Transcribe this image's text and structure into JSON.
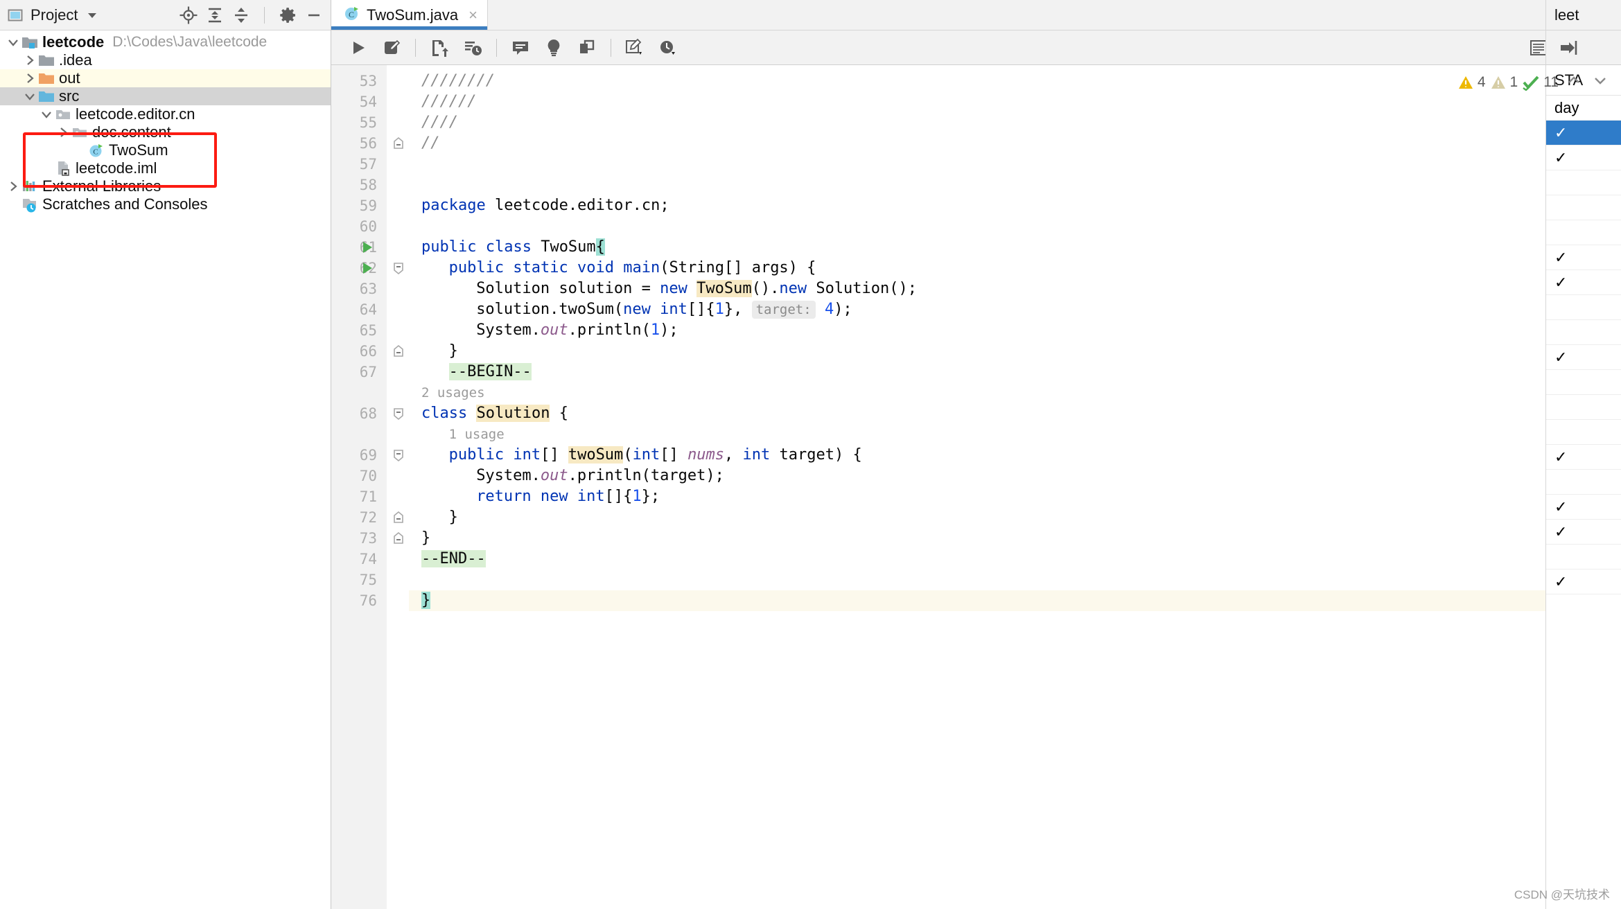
{
  "sidebar": {
    "title": "Project",
    "header_icons": [
      "project-view-icon",
      "chevron-down-icon",
      "locate-icon",
      "expand-all-icon",
      "collapse-all-icon",
      "settings-gear-icon",
      "minimize-icon"
    ],
    "tree": [
      {
        "label": "leetcode",
        "path": "D:\\Codes\\Java\\leetcode",
        "icon": "module-folder-icon",
        "arrow": "expanded",
        "indent": 0,
        "bold": true,
        "state": "normal"
      },
      {
        "label": ".idea",
        "path": "",
        "icon": "folder-grey-icon",
        "arrow": "collapsed",
        "indent": 1,
        "bold": false,
        "state": "normal"
      },
      {
        "label": "out",
        "path": "",
        "icon": "folder-orange-icon",
        "arrow": "collapsed",
        "indent": 1,
        "bold": false,
        "state": "yellow"
      },
      {
        "label": "src",
        "path": "",
        "icon": "folder-blue-icon",
        "arrow": "expanded",
        "indent": 1,
        "bold": false,
        "state": "selected"
      },
      {
        "label": "leetcode.editor.cn",
        "path": "",
        "icon": "package-icon",
        "arrow": "expanded",
        "indent": 2,
        "bold": false,
        "state": "normal"
      },
      {
        "label": "doc.content",
        "path": "",
        "icon": "package-icon",
        "arrow": "collapsed",
        "indent": 3,
        "bold": false,
        "state": "normal"
      },
      {
        "label": "TwoSum",
        "path": "",
        "icon": "java-class-icon",
        "arrow": "none",
        "indent": 4,
        "bold": false,
        "state": "normal"
      },
      {
        "label": "leetcode.iml",
        "path": "",
        "icon": "iml-file-icon",
        "arrow": "none",
        "indent": 2,
        "bold": false,
        "state": "normal"
      },
      {
        "label": "External Libraries",
        "path": "",
        "icon": "libraries-icon",
        "arrow": "collapsed",
        "indent": 0,
        "bold": false,
        "state": "normal"
      },
      {
        "label": "Scratches and Consoles",
        "path": "",
        "icon": "scratches-icon",
        "arrow": "none",
        "indent": 0,
        "bold": false,
        "state": "normal"
      }
    ],
    "highlight_box": {
      "color": "#fc1b12",
      "around": [
        "leetcode.editor.cn",
        "doc.content",
        "TwoSum"
      ]
    }
  },
  "editor": {
    "tab": {
      "label": "TwoSum.java",
      "icon": "java-class-icon",
      "close": "×",
      "active": true,
      "accent": "#3c7ec0"
    },
    "tabbar_kebab": "more-options-icon",
    "toolbar_icons": [
      "run-icon",
      "edit-submission-icon",
      "submit-icon",
      "timer-submit-icon",
      "comment-icon",
      "idea-bulb-icon",
      "note-icon",
      "edit-note-icon",
      "history-clock-icon"
    ],
    "right_toolbar_icons": [
      "list-view-icon",
      "split-view-icon",
      "image-view-icon",
      "open-panel-icon"
    ],
    "inspections": {
      "warning_count": "4",
      "weak_warning_count": "1",
      "ok_count": "11",
      "up_icon": "chevron-up-icon",
      "down_icon": "chevron-down-icon",
      "warning_color": "#edb800",
      "weak_color": "#d6cda6",
      "ok_color": "#4caf50"
    },
    "first_line_number": 53,
    "lines": [
      {
        "n": 53,
        "indent": 0,
        "tokens": [
          {
            "t": "comment",
            "v": "////////"
          }
        ]
      },
      {
        "n": 54,
        "indent": 0,
        "tokens": [
          {
            "t": "comment",
            "v": "//////"
          }
        ]
      },
      {
        "n": 55,
        "indent": 0,
        "tokens": [
          {
            "t": "comment",
            "v": "////"
          }
        ]
      },
      {
        "n": 56,
        "indent": 0,
        "fold": "end",
        "tokens": [
          {
            "t": "comment",
            "v": "//"
          }
        ]
      },
      {
        "n": 57,
        "indent": 0,
        "tokens": []
      },
      {
        "n": 58,
        "indent": 0,
        "tokens": []
      },
      {
        "n": 59,
        "indent": 0,
        "tokens": [
          {
            "t": "kw",
            "v": "package"
          },
          {
            "t": "plain",
            "v": " leetcode.editor.cn;"
          }
        ]
      },
      {
        "n": 60,
        "indent": 0,
        "tokens": []
      },
      {
        "n": 61,
        "indent": 0,
        "run": true,
        "tokens": [
          {
            "t": "kw",
            "v": "public class"
          },
          {
            "t": "plain",
            "v": " TwoSum"
          },
          {
            "t": "cyan",
            "v": "{"
          }
        ]
      },
      {
        "n": 62,
        "indent": 1,
        "run": true,
        "fold": "start",
        "tokens": [
          {
            "t": "kw",
            "v": "public static void"
          },
          {
            "t": "plain",
            "v": " "
          },
          {
            "t": "method",
            "v": "main"
          },
          {
            "t": "plain",
            "v": "(String[] args) {"
          }
        ]
      },
      {
        "n": 63,
        "indent": 2,
        "tokens": [
          {
            "t": "plain",
            "v": "Solution solution = "
          },
          {
            "t": "kw",
            "v": "new"
          },
          {
            "t": "plain",
            "v": " "
          },
          {
            "t": "hl",
            "v": "TwoSum"
          },
          {
            "t": "plain",
            "v": "()."
          },
          {
            "t": "kw",
            "v": "new"
          },
          {
            "t": "plain",
            "v": " Solution();"
          }
        ]
      },
      {
        "n": 64,
        "indent": 2,
        "tokens": [
          {
            "t": "plain",
            "v": "solution.twoSum("
          },
          {
            "t": "kw",
            "v": "new"
          },
          {
            "t": "plain",
            "v": " "
          },
          {
            "t": "kw",
            "v": "int"
          },
          {
            "t": "plain",
            "v": "[]{"
          },
          {
            "t": "num",
            "v": "1"
          },
          {
            "t": "plain",
            "v": "}, "
          },
          {
            "t": "paramhint",
            "v": "target:"
          },
          {
            "t": "plain",
            "v": " "
          },
          {
            "t": "num",
            "v": "4"
          },
          {
            "t": "plain",
            "v": ");"
          }
        ]
      },
      {
        "n": 65,
        "indent": 2,
        "tokens": [
          {
            "t": "plain",
            "v": "System."
          },
          {
            "t": "static",
            "v": "out"
          },
          {
            "t": "plain",
            "v": ".println("
          },
          {
            "t": "num",
            "v": "1"
          },
          {
            "t": "plain",
            "v": ");"
          }
        ]
      },
      {
        "n": 66,
        "indent": 1,
        "fold": "end",
        "tokens": [
          {
            "t": "plain",
            "v": "}"
          }
        ]
      },
      {
        "n": 67,
        "indent": 1,
        "tokens": [
          {
            "t": "green",
            "v": "--BEGIN--"
          }
        ]
      },
      {
        "n": 68,
        "indent": 0,
        "fold": "start",
        "tokens": [
          {
            "t": "kw",
            "v": "class"
          },
          {
            "t": "plain",
            "v": " "
          },
          {
            "t": "hl",
            "v": "Solution"
          },
          {
            "t": "plain",
            "v": " {"
          }
        ]
      },
      {
        "n": 69,
        "indent": 1,
        "fold": "start",
        "tokens": [
          {
            "t": "kw",
            "v": "public"
          },
          {
            "t": "plain",
            "v": " "
          },
          {
            "t": "kw",
            "v": "int"
          },
          {
            "t": "plain",
            "v": "[] "
          },
          {
            "t": "hl",
            "v": "twoSum"
          },
          {
            "t": "plain",
            "v": "("
          },
          {
            "t": "kw",
            "v": "int"
          },
          {
            "t": "plain",
            "v": "[] "
          },
          {
            "t": "param",
            "v": "nums"
          },
          {
            "t": "plain",
            "v": ", "
          },
          {
            "t": "kw",
            "v": "int"
          },
          {
            "t": "plain",
            "v": " target) {"
          }
        ]
      },
      {
        "n": 70,
        "indent": 2,
        "tokens": [
          {
            "t": "plain",
            "v": "System."
          },
          {
            "t": "static",
            "v": "out"
          },
          {
            "t": "plain",
            "v": ".println(target);"
          }
        ]
      },
      {
        "n": 71,
        "indent": 2,
        "tokens": [
          {
            "t": "kw",
            "v": "return new"
          },
          {
            "t": "plain",
            "v": " "
          },
          {
            "t": "kw",
            "v": "int"
          },
          {
            "t": "plain",
            "v": "[]{"
          },
          {
            "t": "num",
            "v": "1"
          },
          {
            "t": "plain",
            "v": "};"
          }
        ]
      },
      {
        "n": 72,
        "indent": 1,
        "fold": "end",
        "tokens": [
          {
            "t": "plain",
            "v": "}"
          }
        ]
      },
      {
        "n": 73,
        "indent": 0,
        "fold": "end",
        "tokens": [
          {
            "t": "plain",
            "v": "}"
          }
        ]
      },
      {
        "n": 74,
        "indent": 0,
        "tokens": [
          {
            "t": "green",
            "v": "--END--"
          }
        ]
      },
      {
        "n": 75,
        "indent": 0,
        "tokens": []
      },
      {
        "n": 76,
        "indent": 0,
        "caret": true,
        "tokens": [
          {
            "t": "cyan",
            "v": "}"
          }
        ]
      }
    ],
    "inlay_hints": [
      {
        "after_line": 67,
        "text": "2 usages"
      },
      {
        "after_line": 68,
        "text": "1 usage"
      }
    ]
  },
  "right_panel": {
    "title": "leet",
    "tool_icon": "open-panel-icon",
    "column_header": "STA",
    "rows": [
      {
        "text": "day",
        "selected": false
      },
      {
        "text": "✓",
        "selected": true
      },
      {
        "text": "✓",
        "selected": false
      },
      {
        "text": "",
        "selected": false
      },
      {
        "text": "",
        "selected": false
      },
      {
        "text": "",
        "selected": false
      },
      {
        "text": "✓",
        "selected": false
      },
      {
        "text": "✓",
        "selected": false
      },
      {
        "text": "",
        "selected": false
      },
      {
        "text": "",
        "selected": false
      },
      {
        "text": "✓",
        "selected": false
      },
      {
        "text": "",
        "selected": false
      },
      {
        "text": "",
        "selected": false
      },
      {
        "text": "",
        "selected": false
      },
      {
        "text": "✓",
        "selected": false
      },
      {
        "text": "",
        "selected": false
      },
      {
        "text": "✓",
        "selected": false
      },
      {
        "text": "✓",
        "selected": false
      },
      {
        "text": "",
        "selected": false
      },
      {
        "text": "✓",
        "selected": false
      }
    ]
  },
  "watermark": "CSDN @天坑技术"
}
